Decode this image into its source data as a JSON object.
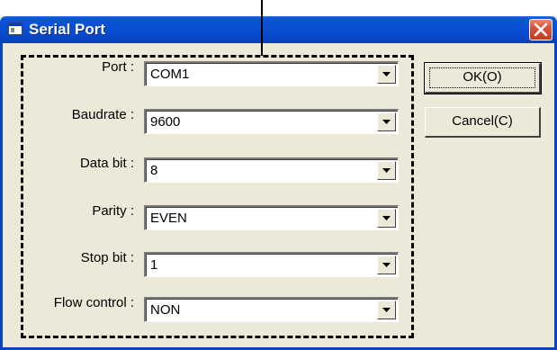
{
  "window": {
    "title": "Serial Port",
    "icon": "app-window-icon",
    "close_icon": "close-icon"
  },
  "fields": [
    {
      "label": "Port :",
      "value": "COM1"
    },
    {
      "label": "Baudrate :",
      "value": "9600"
    },
    {
      "label": "Data bit :",
      "value": "8"
    },
    {
      "label": "Parity :",
      "value": "EVEN"
    },
    {
      "label": "Stop bit :",
      "value": "1"
    },
    {
      "label": "Flow control :",
      "value": "NON"
    }
  ],
  "buttons": {
    "ok_label": "OK(O)",
    "cancel_label": "Cancel(C)"
  },
  "colors": {
    "titlebar": "#0a4fd2",
    "close": "#d6543a",
    "face": "#ece9d8"
  }
}
